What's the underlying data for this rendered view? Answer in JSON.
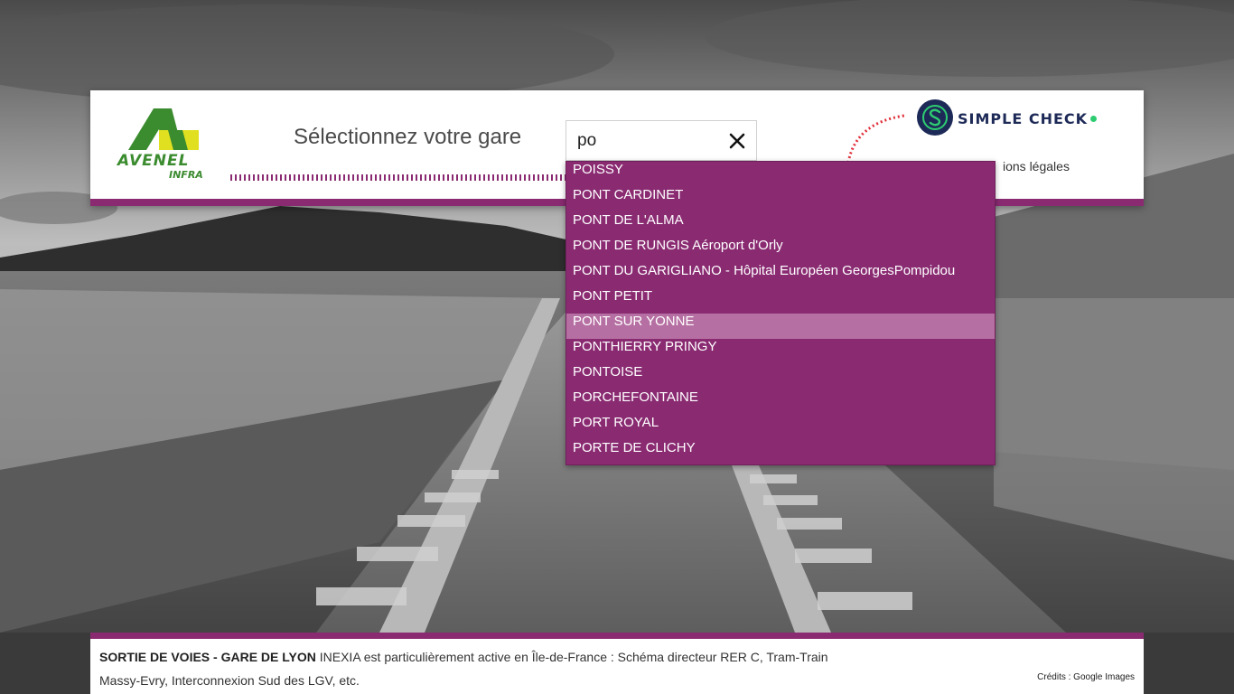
{
  "header": {
    "logo": {
      "main": "AVENEL",
      "sub": "INFRA"
    },
    "prompt": "Sélectionnez votre gare",
    "search": {
      "value": "po"
    },
    "brand": {
      "name": "SIMPLE CHECK"
    },
    "legal_link": "ions légales"
  },
  "dropdown": {
    "items": [
      "POISSY",
      "PONT CARDINET",
      "PONT DE L'ALMA",
      "PONT DE RUNGIS Aéroport d'Orly",
      "PONT DU GARIGLIANO - Hôpital Européen GeorgesPompidou",
      "PONT PETIT",
      "PONT SUR YONNE",
      "PONTHIERRY PRINGY",
      "PONTOISE",
      "PORCHEFONTAINE",
      "PORT ROYAL",
      "PORTE DE CLICHY"
    ],
    "highlighted": "PONT SUR YONNE"
  },
  "footer": {
    "title": "SORTIE DE VOIES - GARE DE LYON",
    "description": "INEXIA est particulièrement active en Île-de-France : Schéma directeur RER C, Tram-Train Massy-Evry, Interconnexion Sud des LGV, etc.",
    "credits": "Crédits : Google Images"
  },
  "colors": {
    "accent": "#8a2b72",
    "highlight": "#b66fa2",
    "brand_navy": "#1d2a57",
    "logo_green": "#3b8b2f",
    "logo_yellow": "#e0e021"
  },
  "icons": {
    "clear": "close-icon",
    "brand": "simple-check-logo"
  }
}
